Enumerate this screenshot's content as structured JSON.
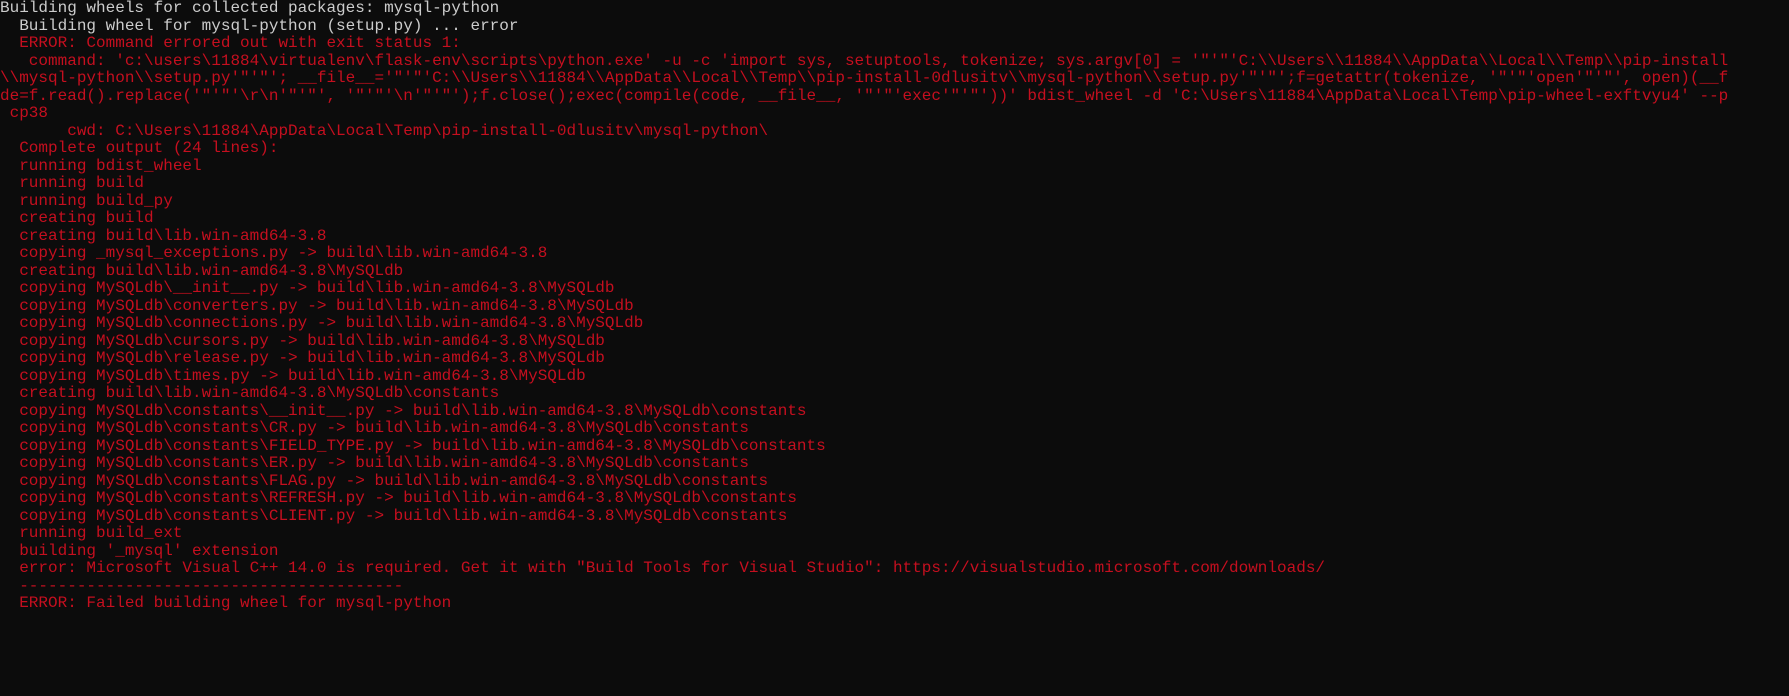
{
  "terminal": {
    "lines": [
      {
        "cls": "white",
        "text": "Building wheels for collected packages: mysql-python"
      },
      {
        "cls": "white",
        "text": "  Building wheel for mysql-python (setup.py) ... error"
      },
      {
        "cls": "red",
        "text": "  ERROR: Command errored out with exit status 1:"
      },
      {
        "cls": "red",
        "text": "   command: 'c:\\users\\11884\\virtualenv\\flask-env\\scripts\\python.exe' -u -c 'import sys, setuptools, tokenize; sys.argv[0] = '\"'\"'C:\\\\Users\\\\11884\\\\AppData\\\\Local\\\\Temp\\\\pip-install"
      },
      {
        "cls": "red",
        "text": "\\\\mysql-python\\\\setup.py'\"'\"'; __file__='\"'\"'C:\\\\Users\\\\11884\\\\AppData\\\\Local\\\\Temp\\\\pip-install-0dlusitv\\\\mysql-python\\\\setup.py'\"'\"';f=getattr(tokenize, '\"'\"'open'\"'\"', open)(__f"
      },
      {
        "cls": "red",
        "text": "de=f.read().replace('\"'\"'\\r\\n'\"'\"', '\"'\"'\\n'\"'\"');f.close();exec(compile(code, __file__, '\"'\"'exec'\"'\"'))' bdist_wheel -d 'C:\\Users\\11884\\AppData\\Local\\Temp\\pip-wheel-exftvyu4' --p"
      },
      {
        "cls": "red",
        "text": " cp38"
      },
      {
        "cls": "red",
        "text": "       cwd: C:\\Users\\11884\\AppData\\Local\\Temp\\pip-install-0dlusitv\\mysql-python\\"
      },
      {
        "cls": "red",
        "text": "  Complete output (24 lines):"
      },
      {
        "cls": "red",
        "text": "  running bdist_wheel"
      },
      {
        "cls": "red",
        "text": "  running build"
      },
      {
        "cls": "red",
        "text": "  running build_py"
      },
      {
        "cls": "red",
        "text": "  creating build"
      },
      {
        "cls": "red",
        "text": "  creating build\\lib.win-amd64-3.8"
      },
      {
        "cls": "red",
        "text": "  copying _mysql_exceptions.py -> build\\lib.win-amd64-3.8"
      },
      {
        "cls": "red",
        "text": "  creating build\\lib.win-amd64-3.8\\MySQLdb"
      },
      {
        "cls": "red",
        "text": "  copying MySQLdb\\__init__.py -> build\\lib.win-amd64-3.8\\MySQLdb"
      },
      {
        "cls": "red",
        "text": "  copying MySQLdb\\converters.py -> build\\lib.win-amd64-3.8\\MySQLdb"
      },
      {
        "cls": "red",
        "text": "  copying MySQLdb\\connections.py -> build\\lib.win-amd64-3.8\\MySQLdb"
      },
      {
        "cls": "red",
        "text": "  copying MySQLdb\\cursors.py -> build\\lib.win-amd64-3.8\\MySQLdb"
      },
      {
        "cls": "red",
        "text": "  copying MySQLdb\\release.py -> build\\lib.win-amd64-3.8\\MySQLdb"
      },
      {
        "cls": "red",
        "text": "  copying MySQLdb\\times.py -> build\\lib.win-amd64-3.8\\MySQLdb"
      },
      {
        "cls": "red",
        "text": "  creating build\\lib.win-amd64-3.8\\MySQLdb\\constants"
      },
      {
        "cls": "red",
        "text": "  copying MySQLdb\\constants\\__init__.py -> build\\lib.win-amd64-3.8\\MySQLdb\\constants"
      },
      {
        "cls": "red",
        "text": "  copying MySQLdb\\constants\\CR.py -> build\\lib.win-amd64-3.8\\MySQLdb\\constants"
      },
      {
        "cls": "red",
        "text": "  copying MySQLdb\\constants\\FIELD_TYPE.py -> build\\lib.win-amd64-3.8\\MySQLdb\\constants"
      },
      {
        "cls": "red",
        "text": "  copying MySQLdb\\constants\\ER.py -> build\\lib.win-amd64-3.8\\MySQLdb\\constants"
      },
      {
        "cls": "red",
        "text": "  copying MySQLdb\\constants\\FLAG.py -> build\\lib.win-amd64-3.8\\MySQLdb\\constants"
      },
      {
        "cls": "red",
        "text": "  copying MySQLdb\\constants\\REFRESH.py -> build\\lib.win-amd64-3.8\\MySQLdb\\constants"
      },
      {
        "cls": "red",
        "text": "  copying MySQLdb\\constants\\CLIENT.py -> build\\lib.win-amd64-3.8\\MySQLdb\\constants"
      },
      {
        "cls": "red",
        "text": "  running build_ext"
      },
      {
        "cls": "red",
        "text": "  building '_mysql' extension"
      },
      {
        "cls": "red",
        "text": "  error: Microsoft Visual C++ 14.0 is required. Get it with \"Build Tools for Visual Studio\": https://visualstudio.microsoft.com/downloads/"
      },
      {
        "cls": "red",
        "text": "  ----------------------------------------"
      },
      {
        "cls": "red",
        "text": "  ERROR: Failed building wheel for mysql-python"
      }
    ]
  }
}
